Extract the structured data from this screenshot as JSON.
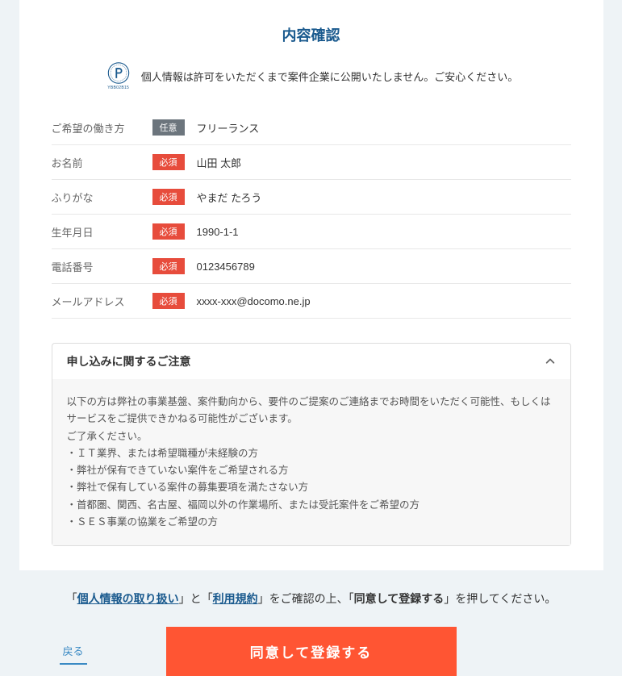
{
  "title": "内容確認",
  "privacy": {
    "pmark_id": "YBB02B15",
    "text": "個人情報は許可をいただくまで案件企業に公開いたしません。ご安心ください。"
  },
  "badges": {
    "optional": "任意",
    "required": "必須"
  },
  "fields": {
    "workstyle": {
      "label": "ご希望の働き方",
      "value": "フリーランス"
    },
    "name": {
      "label": "お名前",
      "value": "山田 太郎"
    },
    "kana": {
      "label": "ふりがな",
      "value": "やまだ たろう"
    },
    "birth": {
      "label": "生年月日",
      "value": "1990-1-1"
    },
    "phone": {
      "label": "電話番号",
      "value": "0123456789"
    },
    "email": {
      "label": "メールアドレス",
      "value": "xxxx-xxx@docomo.ne.jp"
    }
  },
  "accordion": {
    "title": "申し込みに関するご注意",
    "intro1": "以下の方は弊社の事業基盤、案件動向から、要件のご提案のご連絡までお時間をいただく可能性、もしくはサービスをご提供できかねる可能性がございます。",
    "intro2": "ご了承ください。",
    "items": [
      "ＩＴ業界、または希望職種が未経験の方",
      "弊社が保有できていない案件をご希望される方",
      "弊社で保有している案件の募集要項を満たさない方",
      "首都圏、関西、名古屋、福岡以外の作業場所、または受託案件をご希望の方",
      "ＳＥＳ事業の協業をご希望の方"
    ]
  },
  "agreement": {
    "open1": "「",
    "link1": "個人情報の取り扱い",
    "mid1": "」と「",
    "link2": "利用規約",
    "mid2": "」をご確認の上、「",
    "boldtext": "同意して登録する",
    "close": "」を押してください。"
  },
  "buttons": {
    "back": "戻る",
    "submit": "同意して登録する"
  }
}
